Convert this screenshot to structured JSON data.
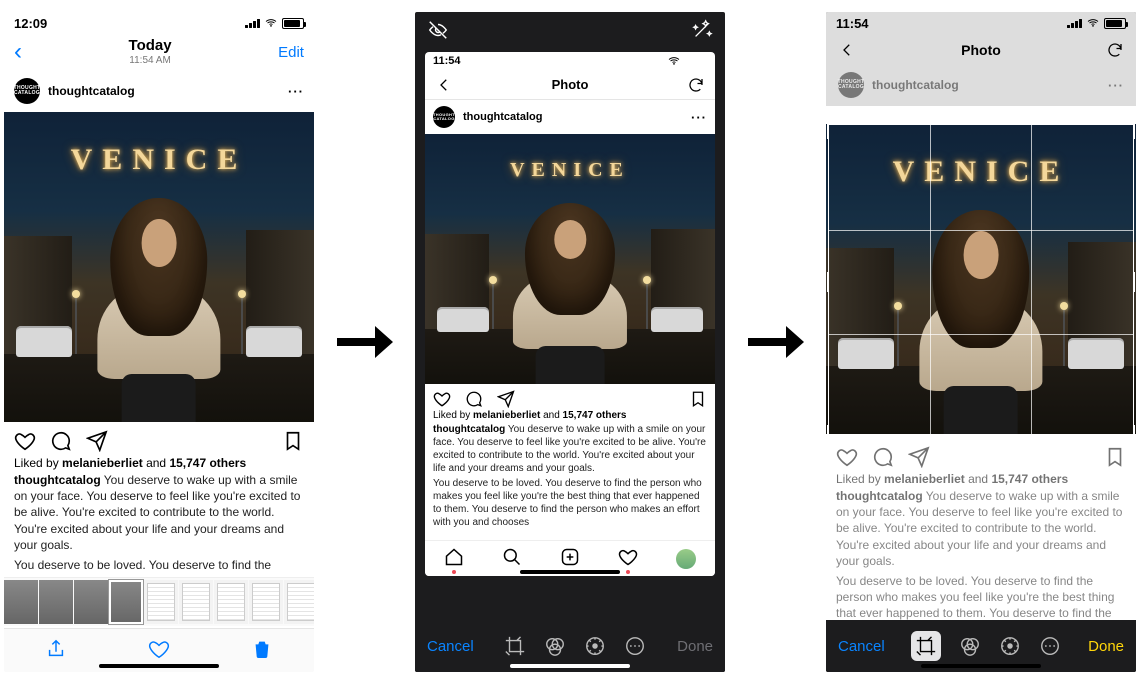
{
  "phone1": {
    "status_time": "12:09",
    "nav_title": "Today",
    "nav_subtitle": "11:54 AM",
    "edit_label": "Edit"
  },
  "post": {
    "avatar_text": "THOUGHT CATALOG",
    "username": "thoughtcatalog",
    "sign_text": "VENICE",
    "liked_prefix": "Liked by ",
    "liked_user": "melanieberliet",
    "liked_mid": " and ",
    "liked_count": "15,747 others",
    "caption1": "You deserve to wake up with a smile on your face. You deserve to feel like you're excited to be alive. You're excited to contribute to the world. You're excited about your life and your dreams and your goals.",
    "caption2": "You deserve to be loved. You deserve to find the",
    "caption2_long": "You deserve to be loved. You deserve to find the person who makes you feel like you're the best thing that ever happened to them. You deserve to find the person who makes an effort with you and chooses"
  },
  "inner": {
    "status_time": "11:54",
    "nav_title": "Photo"
  },
  "editor": {
    "cancel": "Cancel",
    "done": "Done"
  }
}
